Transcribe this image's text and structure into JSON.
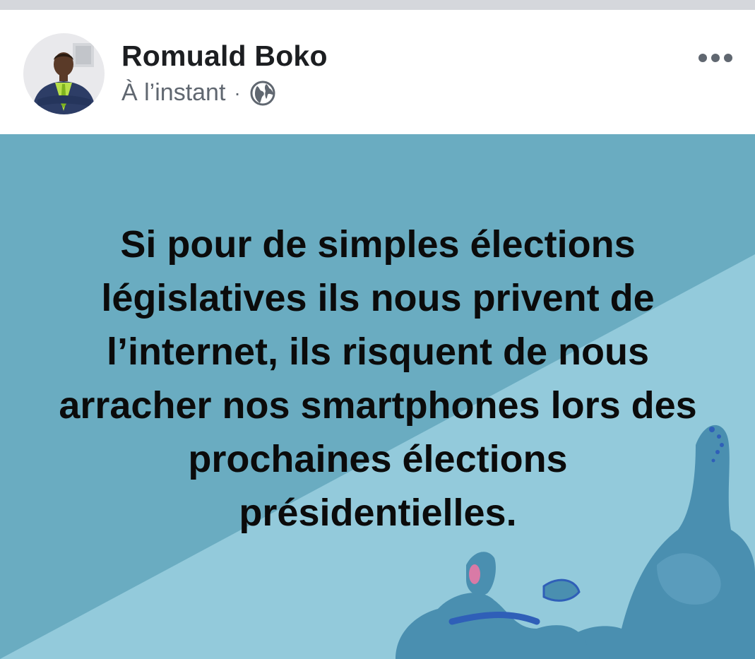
{
  "author": {
    "name": "Romuald Boko",
    "timestamp": "À l’instant",
    "separator": "·",
    "privacy_icon": "globe-icon"
  },
  "header": {
    "more_icon": "more-options-icon"
  },
  "post": {
    "text": "Si pour de simples élections législatives ils nous privent de l’internet, ils risquent de nous arracher nos smartphones lors des prochaines élections présidentielles.",
    "background_colors": {
      "dark": "#6aacc1",
      "light": "#93cadb",
      "illustration": "#4a8fb0"
    }
  }
}
